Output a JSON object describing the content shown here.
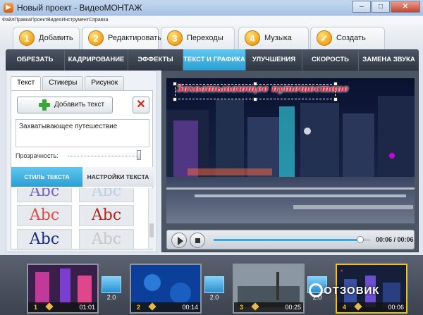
{
  "window": {
    "title": "Новый проект - ВидеоМОНТАЖ"
  },
  "menu": [
    "Файл",
    "Правка",
    "Проект",
    "Видео",
    "Инструмент",
    "Справка"
  ],
  "steps": [
    {
      "num": "1",
      "label": "Добавить"
    },
    {
      "num": "2",
      "label": "Редактировать"
    },
    {
      "num": "3",
      "label": "Переходы"
    },
    {
      "num": "4",
      "label": "Музыка"
    },
    {
      "num": "✓",
      "label": "Создать"
    }
  ],
  "tabs": [
    "ОБРЕЗАТЬ ВИДЕО",
    "КАДРИРОВАНИЕ",
    "ЭФФЕКТЫ",
    "ТЕКСТ И ГРАФИКА",
    "УЛУЧШЕНИЯ",
    "СКОРОСТЬ",
    "ЗАМЕНА ЗВУКА"
  ],
  "panel": {
    "subtabs": [
      "Текст",
      "Стикеры",
      "Рисунок"
    ],
    "add_text": "Добавить текст",
    "text_value": "Захватывающее путешествие",
    "opacity_label": "Прозрачность:",
    "section_tabs": [
      "СТИЛЬ ТЕКСТА",
      "НАСТРОЙКИ ТЕКСТА"
    ],
    "styles": [
      {
        "text": "Abc",
        "color": "#7a5fd0"
      },
      {
        "text": "Abc",
        "color": "#bcd0e6"
      },
      {
        "text": "Abc",
        "color": "#e24a4a"
      },
      {
        "text": "Abc",
        "color": "#b2281a"
      },
      {
        "text": "Abc",
        "color": "#1b2a8a"
      },
      {
        "text": "Abc",
        "color": "#c7c7c7"
      }
    ]
  },
  "preview": {
    "overlay_text": "Захватывающее путешествие",
    "time": "00:06 / 00:06",
    "progress": 0.96
  },
  "timeline": {
    "clips": [
      {
        "num": "1",
        "time": "01:01"
      },
      {
        "num": "2",
        "time": "00:14"
      },
      {
        "num": "3",
        "time": "00:25"
      },
      {
        "num": "4",
        "time": "00:06"
      }
    ],
    "transitions": [
      "2.0",
      "2.0",
      "2.0"
    ]
  },
  "watermark": "ОТЗОВИК",
  "colors": {
    "accent": "#2c9fd4",
    "step_orange": "#f2a31a",
    "delete_red": "#d12a1e"
  }
}
